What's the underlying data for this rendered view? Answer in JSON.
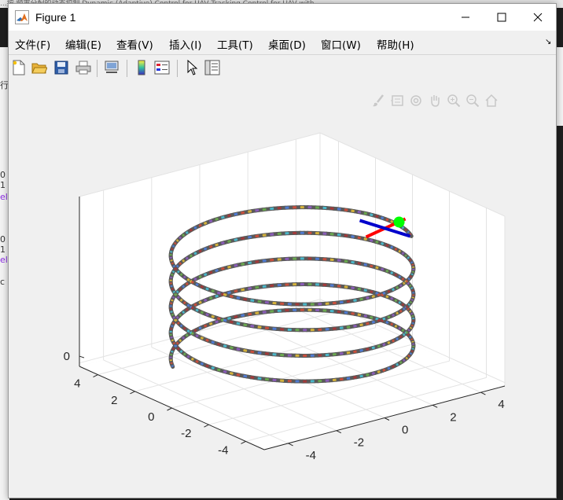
{
  "background": {
    "top_text": "...按 频率分配的动态控制 Dynamic (Adaptive) Control for UAV Tracking Control for UAV with ...",
    "left_snippets": [
      "行",
      "0 1",
      "el",
      "0 1",
      "el",
      "c"
    ]
  },
  "window": {
    "title": "Figure 1",
    "app_icon": "matlab-icon"
  },
  "menu": {
    "items": [
      "文件(F)",
      "编辑(E)",
      "查看(V)",
      "插入(I)",
      "工具(T)",
      "桌面(D)",
      "窗口(W)",
      "帮助(H)"
    ],
    "dock_glyph": "↘"
  },
  "toolbar": {
    "icons": [
      "new-figure-icon",
      "open-file-icon",
      "save-icon",
      "print-icon",
      "link-plot-icon",
      "colorbar-icon",
      "legend-icon",
      "pointer-icon",
      "property-inspector-icon"
    ]
  },
  "axes_toolbar": {
    "icons": [
      "brush-icon",
      "datatip-icon",
      "rotate-icon",
      "pan-icon",
      "zoom-in-icon",
      "zoom-out-icon",
      "home-icon"
    ]
  },
  "chart_data": {
    "type": "line",
    "title": "",
    "xlabel": "",
    "ylabel": "",
    "zlabel": "",
    "xlim": [
      -5,
      5
    ],
    "ylim": [
      -5,
      5
    ],
    "z_tick_labels": [
      "0"
    ],
    "x_tick_labels": [
      "4",
      "2",
      "0",
      "-2",
      "-4"
    ],
    "y_tick_labels": [
      "-4",
      "-2",
      "0",
      "2",
      "4"
    ],
    "grid": true,
    "view": "3D",
    "series": [
      {
        "kind": "helix",
        "radius": 4,
        "turns": 4.5,
        "color": "multicolor-dashed"
      }
    ],
    "annotations": [
      {
        "kind": "marker",
        "color": "#00ff00"
      },
      {
        "kind": "segment",
        "color": "#ff0000"
      },
      {
        "kind": "segment",
        "color": "#0000cc"
      }
    ]
  }
}
